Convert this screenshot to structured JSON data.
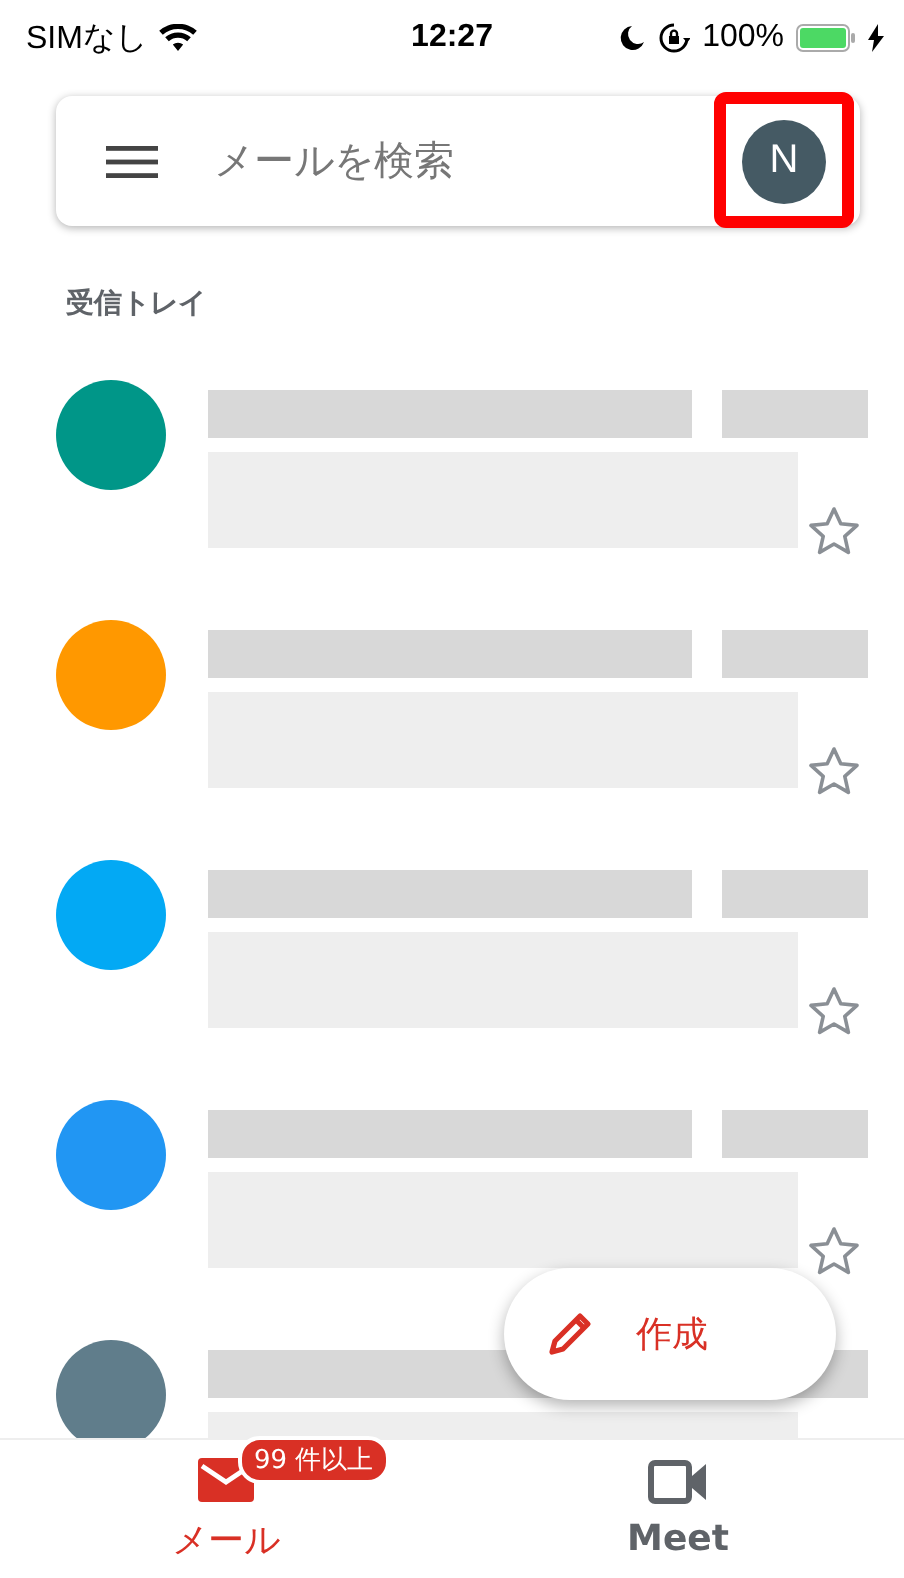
{
  "status_bar": {
    "carrier": "SIMなし",
    "time": "12:27",
    "battery_text": "100%"
  },
  "search": {
    "placeholder": "メールを検索",
    "account_initial": "N",
    "account_highlighted": true
  },
  "section_label": "受信トレイ",
  "rows": [
    {
      "color": "#009688",
      "starred": false
    },
    {
      "color": "#ff9800",
      "starred": false
    },
    {
      "color": "#03a9f4",
      "starred": false
    },
    {
      "color": "#2196f3",
      "starred": false
    },
    {
      "color": "#607d8b"
    }
  ],
  "compose_button": {
    "label": "作成"
  },
  "nav": [
    {
      "kind": "mail",
      "label": "メール",
      "badge": "99 件以上",
      "selected": true
    },
    {
      "kind": "meet",
      "label": "Meet",
      "selected": false
    }
  ]
}
